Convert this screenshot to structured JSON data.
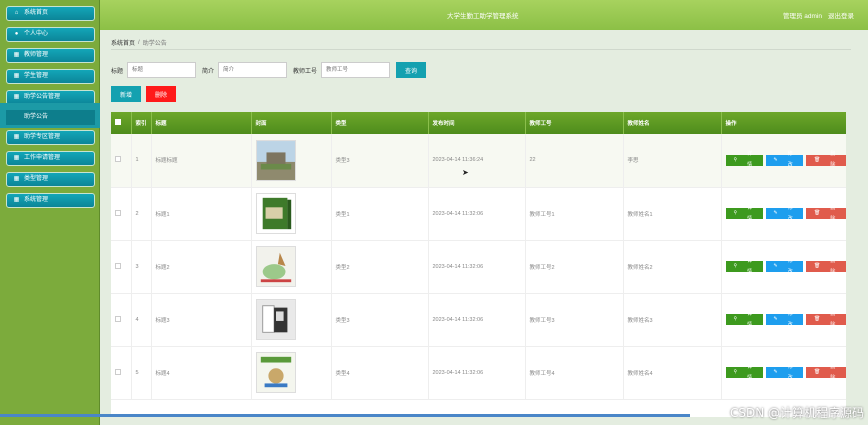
{
  "header": {
    "title": "大学生勤工助学管理系统",
    "user_text": "管理员 admin",
    "logout": "退出登录"
  },
  "sidebar": {
    "items": [
      {
        "label": "系统首页",
        "icon": "home-icon"
      },
      {
        "label": "个人中心",
        "icon": "user-icon"
      },
      {
        "label": "教师管理",
        "icon": "grid-icon"
      },
      {
        "label": "学生管理",
        "icon": "grid-icon"
      },
      {
        "label": "助学公告管理",
        "icon": "grid-icon"
      },
      {
        "label": "助学专区管理",
        "icon": "grid-icon"
      },
      {
        "label": "工作申请管理",
        "icon": "grid-icon"
      },
      {
        "label": "类型管理",
        "icon": "grid-icon"
      },
      {
        "label": "系统管理",
        "icon": "grid-icon"
      }
    ],
    "sub_item": "助学公告"
  },
  "breadcrumb": {
    "home": "系统首页",
    "current": "助学公告"
  },
  "search": {
    "title_label": "标题",
    "title_placeholder": "标题",
    "intro_label": "简介",
    "intro_placeholder": "简介",
    "teacher_label": "教师工号",
    "teacher_placeholder": "教师工号",
    "query": "查询"
  },
  "actions": {
    "add": "新增",
    "delete": "删除"
  },
  "table": {
    "columns": [
      "索引",
      "标题",
      "封面",
      "类型",
      "发布时间",
      "教师工号",
      "教师姓名",
      "操作"
    ],
    "rows": [
      {
        "index": "1",
        "title": "标题标题",
        "type": "类型3",
        "time": "2023-04-14 11:36:24",
        "teacher_id": "22",
        "teacher_name": "李思"
      },
      {
        "index": "2",
        "title": "标题1",
        "type": "类型1",
        "time": "2023-04-14 11:32:06",
        "teacher_id": "教师工号1",
        "teacher_name": "教师姓名1"
      },
      {
        "index": "3",
        "title": "标题2",
        "type": "类型2",
        "time": "2023-04-14 11:32:06",
        "teacher_id": "教师工号2",
        "teacher_name": "教师姓名2"
      },
      {
        "index": "4",
        "title": "标题3",
        "type": "类型3",
        "time": "2023-04-14 11:32:06",
        "teacher_id": "教师工号3",
        "teacher_name": "教师姓名3"
      },
      {
        "index": "5",
        "title": "标题4",
        "type": "类型4",
        "time": "2023-04-14 11:32:06",
        "teacher_id": "教师工号4",
        "teacher_name": "教师姓名4"
      }
    ],
    "op_view": "详情",
    "op_edit": "修改",
    "op_delete": "删除"
  },
  "watermark": "CSDN @计算机程序源码"
}
